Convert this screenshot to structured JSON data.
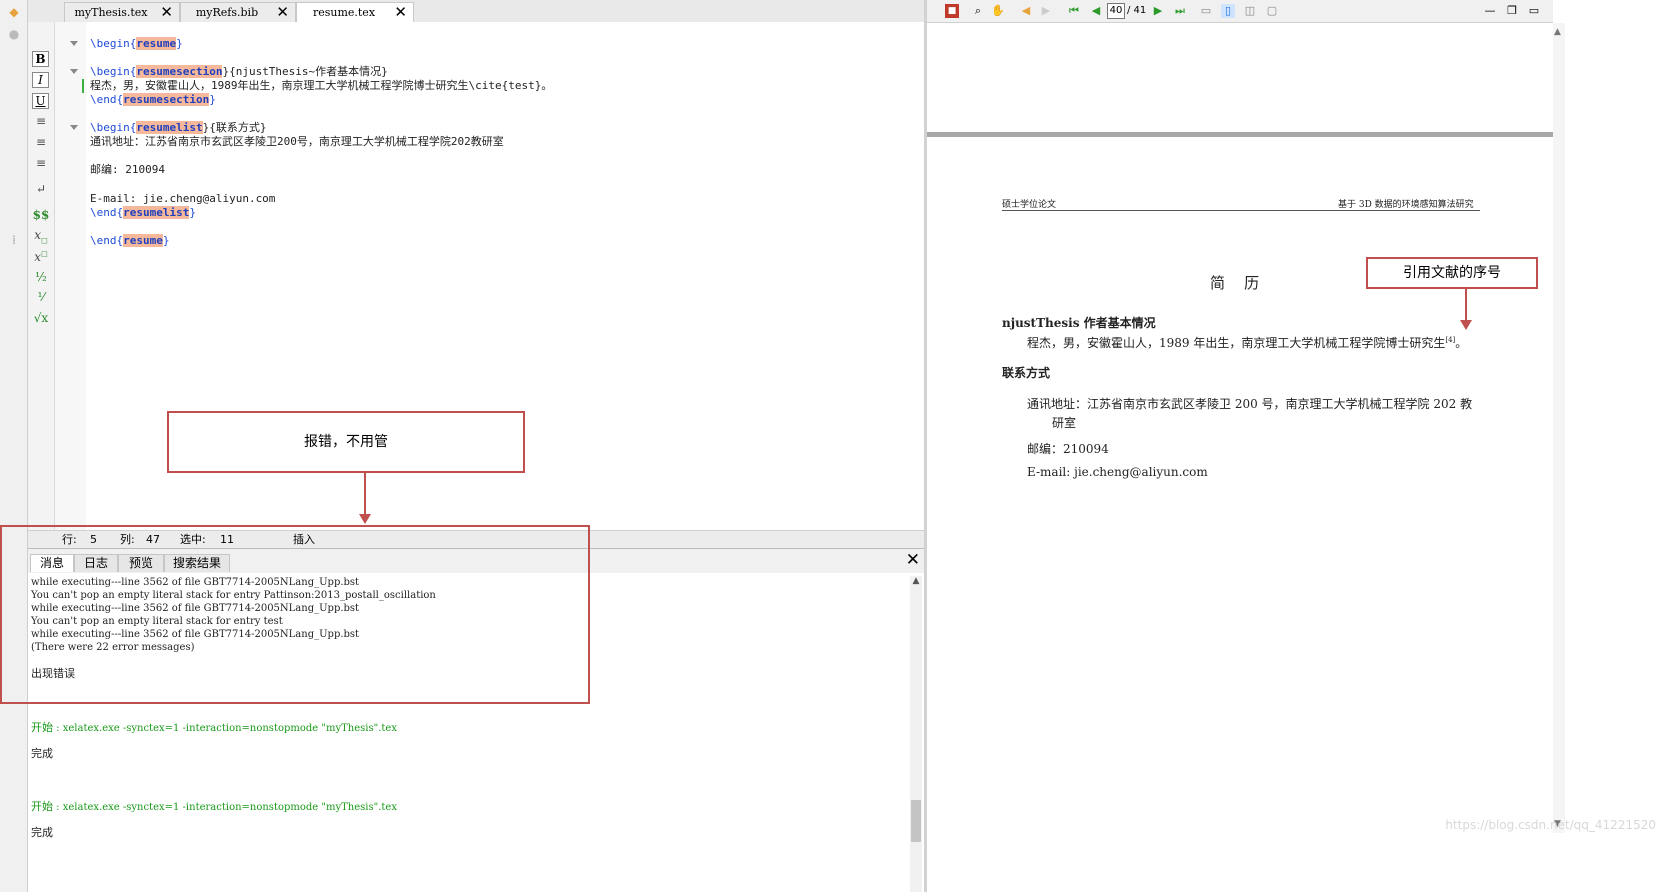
{
  "editor": {
    "tabs": [
      {
        "label": "myThesis.tex",
        "close": "✕"
      },
      {
        "label": "myRefs.bib",
        "close": "✕"
      },
      {
        "label": "resume.tex",
        "close": "✕"
      }
    ],
    "format_buttons": {
      "bold": "B",
      "italic": "I",
      "underline": "U"
    },
    "code": {
      "l1_cmd": "\\begin{",
      "l1_arg": "resume",
      "l1_end": "}",
      "l2_cmd": "\\begin{",
      "l2_arg": "resumesection",
      "l2_rest": "}{njustThesis~作者基本情况}",
      "l3": "程杰，男，安徽霍山人，1989年出生，南京理工大学机械工程学院博士研究生\\cite{test}。",
      "l4_cmd": "\\end{",
      "l4_arg": "resumesection",
      "l4_end": "}",
      "l5_cmd": "\\begin{",
      "l5_arg": "resumelist",
      "l5_rest": "}{联系方式}",
      "l6": "通讯地址：江苏省南京市玄武区孝陵卫200号，南京理工大学机械工程学院202教研室",
      "l7": "邮编: 210094",
      "l8": "E-mail: jie.cheng@aliyun.com",
      "l9_cmd": "\\end{",
      "l9_arg": "resumelist",
      "l9_end": "}",
      "l10_cmd": "\\end{",
      "l10_arg": "resume",
      "l10_end": "}"
    }
  },
  "status_bar": {
    "row_label": "行:",
    "row": "5",
    "col_label": "列:",
    "col": "47",
    "sel_label": "选中:",
    "sel": "11",
    "mode": "插入"
  },
  "messages": {
    "tabs": [
      "消息",
      "日志",
      "预览",
      "搜索结果"
    ],
    "close": "✕",
    "lines": [
      "while executing---line 3562 of file GBT7714-2005NLang_Upp.bst",
      "You can't pop an empty literal stack for entry Pattinson:2013_postall_oscillation",
      "while executing---line 3562 of file GBT7714-2005NLang_Upp.bst",
      "You can't pop an empty literal stack for entry test",
      "while executing---line 3562 of file GBT7714-2005NLang_Upp.bst",
      "(There were 22 error messages)"
    ],
    "error": "出现错误",
    "run1_label": "开始",
    "run1_cmd": " : xelatex.exe -synctex=1 -interaction=nonstopmode \"myThesis\".tex",
    "done1": "完成",
    "run2_label": "开始",
    "run2_cmd": " : xelatex.exe -synctex=1 -interaction=nonstopmode \"myThesis\".tex",
    "done2": "完成"
  },
  "annotations": {
    "error_note": "报错，不用管",
    "citation_note": "引用文献的序号"
  },
  "viewer": {
    "page_current": "40",
    "page_total": "/ 41"
  },
  "pdf_page": {
    "header_left": "硕士学位论文",
    "header_right": "基于 3D 数据的环境感知算法研究",
    "title": "简    历",
    "section1": "njustThesis 作者基本情况",
    "bio": "程杰，男，安徽霍山人，1989 年出生，南京理工大学机械工程学院博士研究生",
    "cite": "[4]",
    "bio_end": "。",
    "section2": "联系方式",
    "address_1": "通讯地址：江苏省南京市玄武区孝陵卫 200 号，南京理工大学机械工程学院 202 教",
    "address_2": "研室",
    "postcode": "邮编：210094",
    "email": "E-mail: jie.cheng@aliyun.com"
  },
  "watermark": "https://blog.csdn.net/qq_41221520",
  "colors": {
    "annotation_red": "#c0504d",
    "latex_arg_highlight": "#f5b89a",
    "log_green": "#1a9a1a"
  }
}
